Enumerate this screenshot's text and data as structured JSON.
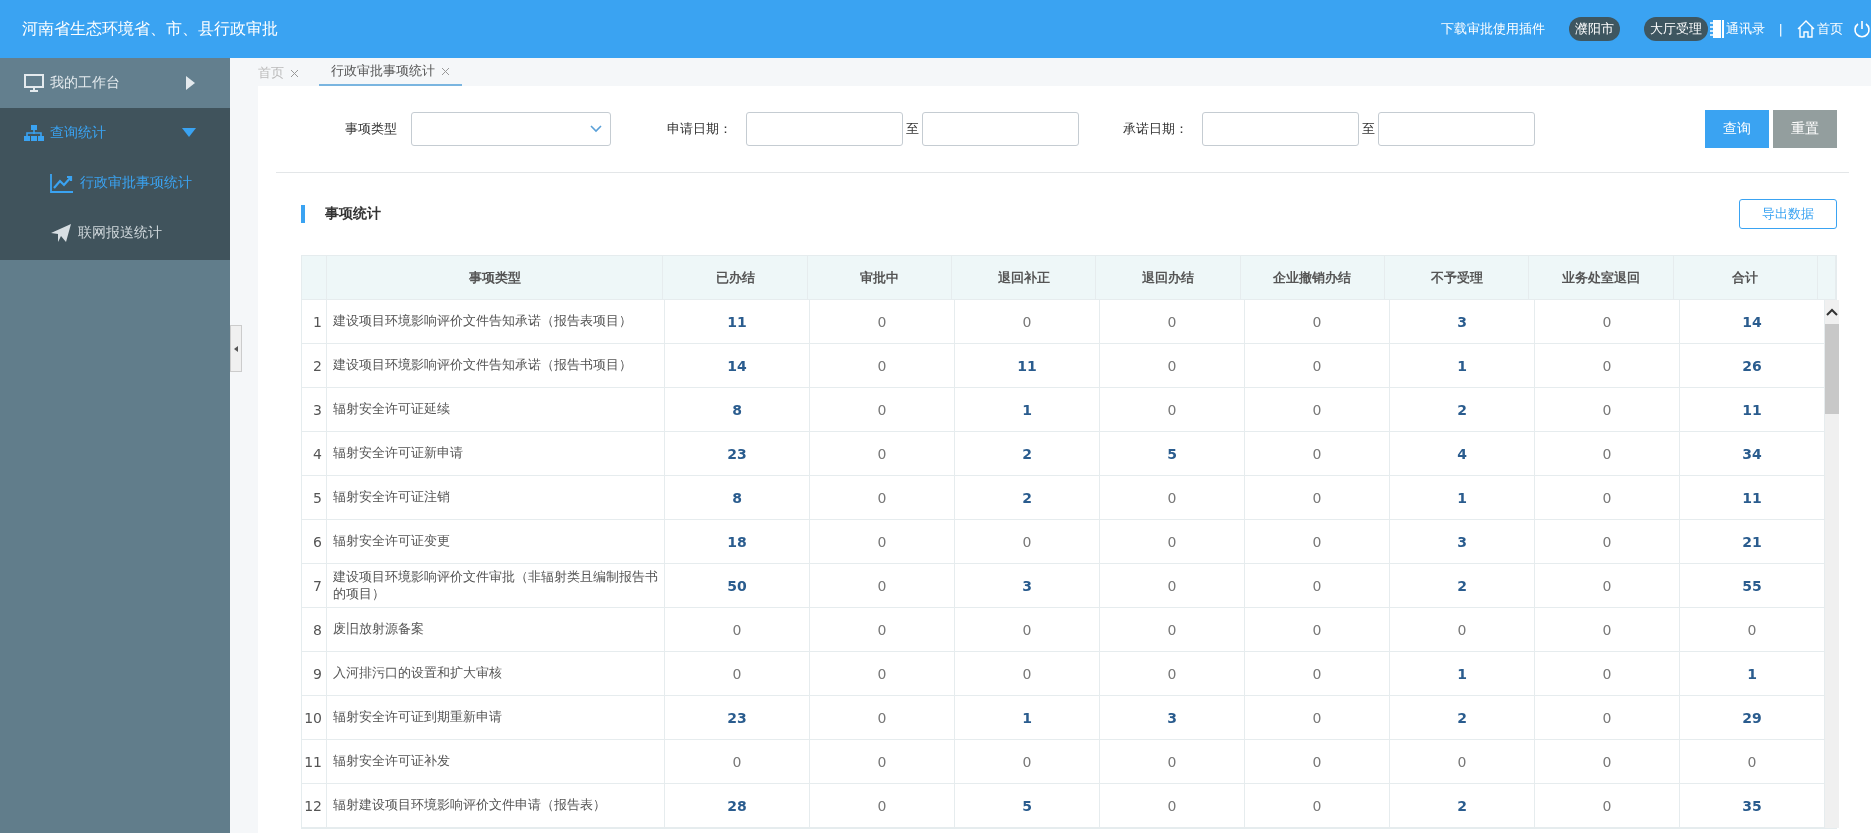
{
  "header": {
    "title": "河南省生态环境省、市、县行政审批",
    "links": [
      {
        "kind": "text",
        "label": "下载审批使用插件"
      },
      {
        "kind": "pill",
        "label": "濮阳市"
      },
      {
        "kind": "pill",
        "label": "大厅受理"
      },
      {
        "kind": "book",
        "label": "通讯录"
      },
      {
        "kind": "divider",
        "label": "|"
      },
      {
        "kind": "home",
        "label": "首页"
      },
      {
        "kind": "power"
      }
    ]
  },
  "sidebar": {
    "items": [
      {
        "label": "我的工作台",
        "expanded": false,
        "selected": false
      },
      {
        "label": "查询统计",
        "expanded": true,
        "selected": true,
        "children": [
          {
            "label": "行政审批事项统计",
            "selected": true
          },
          {
            "label": "联网报送统计",
            "selected": false
          }
        ]
      }
    ]
  },
  "tabs": [
    {
      "label": "首页",
      "selected": false
    },
    {
      "label": "行政审批事项统计",
      "selected": true
    }
  ],
  "filters": {
    "type_label": "事项类型",
    "apply_label": "申请日期：",
    "promise_label": "承诺日期：",
    "to_label_1": "至",
    "to_label_2": "至",
    "query_button": "查询",
    "reset_button": "重置"
  },
  "section": {
    "title": "事项统计",
    "export_button": "导出数据"
  },
  "table": {
    "columns": [
      "",
      "事项类型",
      "已办结",
      "审批中",
      "退回补正",
      "退回办结",
      "企业撤销办结",
      "不予受理",
      "业务处室退回",
      "合计"
    ],
    "rows": [
      {
        "cells": [
          {
            "value": "1",
            "bold": false
          },
          {
            "value": "建设项目环境影响评价文件告知承诺（报告表项目）",
            "bold": false
          },
          {
            "value": "11",
            "bold": true
          },
          {
            "value": "0",
            "bold": false
          },
          {
            "value": "0",
            "bold": false
          },
          {
            "value": "0",
            "bold": false
          },
          {
            "value": "0",
            "bold": false
          },
          {
            "value": "3",
            "bold": true
          },
          {
            "value": "0",
            "bold": false
          },
          {
            "value": "14",
            "bold": true
          }
        ]
      },
      {
        "cells": [
          {
            "value": "2",
            "bold": false
          },
          {
            "value": "建设项目环境影响评价文件告知承诺（报告书项目）",
            "bold": false
          },
          {
            "value": "14",
            "bold": true
          },
          {
            "value": "0",
            "bold": false
          },
          {
            "value": "11",
            "bold": true
          },
          {
            "value": "0",
            "bold": false
          },
          {
            "value": "0",
            "bold": false
          },
          {
            "value": "1",
            "bold": true
          },
          {
            "value": "0",
            "bold": false
          },
          {
            "value": "26",
            "bold": true
          }
        ]
      },
      {
        "cells": [
          {
            "value": "3",
            "bold": false
          },
          {
            "value": "辐射安全许可证延续",
            "bold": false
          },
          {
            "value": "8",
            "bold": true
          },
          {
            "value": "0",
            "bold": false
          },
          {
            "value": "1",
            "bold": true
          },
          {
            "value": "0",
            "bold": false
          },
          {
            "value": "0",
            "bold": false
          },
          {
            "value": "2",
            "bold": true
          },
          {
            "value": "0",
            "bold": false
          },
          {
            "value": "11",
            "bold": true
          }
        ]
      },
      {
        "cells": [
          {
            "value": "4",
            "bold": false
          },
          {
            "value": "辐射安全许可证新申请",
            "bold": false
          },
          {
            "value": "23",
            "bold": true
          },
          {
            "value": "0",
            "bold": false
          },
          {
            "value": "2",
            "bold": true
          },
          {
            "value": "5",
            "bold": true
          },
          {
            "value": "0",
            "bold": false
          },
          {
            "value": "4",
            "bold": true
          },
          {
            "value": "0",
            "bold": false
          },
          {
            "value": "34",
            "bold": true
          }
        ]
      },
      {
        "cells": [
          {
            "value": "5",
            "bold": false
          },
          {
            "value": "辐射安全许可证注销",
            "bold": false
          },
          {
            "value": "8",
            "bold": true
          },
          {
            "value": "0",
            "bold": false
          },
          {
            "value": "2",
            "bold": true
          },
          {
            "value": "0",
            "bold": false
          },
          {
            "value": "0",
            "bold": false
          },
          {
            "value": "1",
            "bold": true
          },
          {
            "value": "0",
            "bold": false
          },
          {
            "value": "11",
            "bold": true
          }
        ]
      },
      {
        "cells": [
          {
            "value": "6",
            "bold": false
          },
          {
            "value": "辐射安全许可证变更",
            "bold": false
          },
          {
            "value": "18",
            "bold": true
          },
          {
            "value": "0",
            "bold": false
          },
          {
            "value": "0",
            "bold": false
          },
          {
            "value": "0",
            "bold": false
          },
          {
            "value": "0",
            "bold": false
          },
          {
            "value": "3",
            "bold": true
          },
          {
            "value": "0",
            "bold": false
          },
          {
            "value": "21",
            "bold": true
          }
        ]
      },
      {
        "cells": [
          {
            "value": "7",
            "bold": false
          },
          {
            "value": "建设项目环境影响评价文件审批（非辐射类且编制报告书的项目）",
            "bold": false
          },
          {
            "value": "50",
            "bold": true
          },
          {
            "value": "0",
            "bold": false
          },
          {
            "value": "3",
            "bold": true
          },
          {
            "value": "0",
            "bold": false
          },
          {
            "value": "0",
            "bold": false
          },
          {
            "value": "2",
            "bold": true
          },
          {
            "value": "0",
            "bold": false
          },
          {
            "value": "55",
            "bold": true
          }
        ]
      },
      {
        "cells": [
          {
            "value": "8",
            "bold": false
          },
          {
            "value": "废旧放射源备案",
            "bold": false
          },
          {
            "value": "0",
            "bold": false
          },
          {
            "value": "0",
            "bold": false
          },
          {
            "value": "0",
            "bold": false
          },
          {
            "value": "0",
            "bold": false
          },
          {
            "value": "0",
            "bold": false
          },
          {
            "value": "0",
            "bold": false
          },
          {
            "value": "0",
            "bold": false
          },
          {
            "value": "0",
            "bold": false
          }
        ]
      },
      {
        "cells": [
          {
            "value": "9",
            "bold": false
          },
          {
            "value": "入河排污口的设置和扩大审核",
            "bold": false
          },
          {
            "value": "0",
            "bold": false
          },
          {
            "value": "0",
            "bold": false
          },
          {
            "value": "0",
            "bold": false
          },
          {
            "value": "0",
            "bold": false
          },
          {
            "value": "0",
            "bold": false
          },
          {
            "value": "1",
            "bold": true
          },
          {
            "value": "0",
            "bold": false
          },
          {
            "value": "1",
            "bold": true
          }
        ]
      },
      {
        "cells": [
          {
            "value": "10",
            "bold": false
          },
          {
            "value": "辐射安全许可证到期重新申请",
            "bold": false
          },
          {
            "value": "23",
            "bold": true
          },
          {
            "value": "0",
            "bold": false
          },
          {
            "value": "1",
            "bold": true
          },
          {
            "value": "3",
            "bold": true
          },
          {
            "value": "0",
            "bold": false
          },
          {
            "value": "2",
            "bold": true
          },
          {
            "value": "0",
            "bold": false
          },
          {
            "value": "29",
            "bold": true
          }
        ]
      },
      {
        "cells": [
          {
            "value": "11",
            "bold": false
          },
          {
            "value": "辐射安全许可证补发",
            "bold": false
          },
          {
            "value": "0",
            "bold": false
          },
          {
            "value": "0",
            "bold": false
          },
          {
            "value": "0",
            "bold": false
          },
          {
            "value": "0",
            "bold": false
          },
          {
            "value": "0",
            "bold": false
          },
          {
            "value": "0",
            "bold": false
          },
          {
            "value": "0",
            "bold": false
          },
          {
            "value": "0",
            "bold": false
          }
        ]
      },
      {
        "cells": [
          {
            "value": "12",
            "bold": false
          },
          {
            "value": "辐射建设项目环境影响评价文件申请（报告表）",
            "bold": false
          },
          {
            "value": "28",
            "bold": true
          },
          {
            "value": "0",
            "bold": false
          },
          {
            "value": "5",
            "bold": true
          },
          {
            "value": "0",
            "bold": false
          },
          {
            "value": "0",
            "bold": false
          },
          {
            "value": "2",
            "bold": true
          },
          {
            "value": "0",
            "bold": false
          },
          {
            "value": "35",
            "bold": true
          }
        ]
      }
    ]
  }
}
